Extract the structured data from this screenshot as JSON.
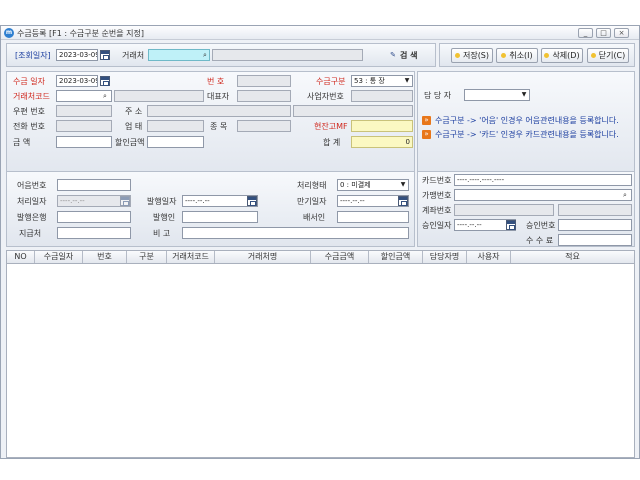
{
  "window": {
    "title": "수금등록 [F1 : 수금구분 순번을 지정]",
    "app_icon": "m",
    "controls": [
      "minimize-icon",
      "maximize-icon",
      "close-icon"
    ]
  },
  "search": {
    "date_label": "[조회일자]",
    "date_value": "2023-03-09",
    "client_label": "거래처",
    "client_value": "",
    "search_label": "검 색"
  },
  "toolbar": {
    "save": "저장(S)",
    "cancel": "취소(I)",
    "delete": "삭제(D)",
    "close": "닫기(C)"
  },
  "form": {
    "collect_date_label": "수금 일자",
    "collect_date_value": "2023-03-09",
    "number_label": "번 호",
    "collect_type_label": "수금구분",
    "collect_type_value": "53 : 통 장",
    "client_code_label": "거래처코드",
    "rep_label": "대표자",
    "bizno_label": "사업자번호",
    "manager_label": "담 당 자",
    "zip_label": "우편 번호",
    "address_label": "주 소",
    "phone_label": "전화 번호",
    "biztype_label": "업 태",
    "item_label": "종 목",
    "balance_label": "현잔고MF",
    "amount_label": "금 액",
    "discount_label": "할인금액",
    "total_label": "합 계",
    "total_value": "0",
    "note1": "수금구분 -> '어음' 인경우 어음관련내용을 등록합니다.",
    "note2": "수금구분 -> '카드' 인경우 카드관련내용을 등록합니다."
  },
  "bill": {
    "bill_no_label": "어음번호",
    "process_type_label": "처리형태",
    "process_type_value": "0 : 미결제",
    "process_date_label": "처리일자",
    "process_date_value": "----.--.--",
    "issue_date_label": "발행일자",
    "issue_date_value": "----.--.--",
    "due_date_label": "만기일자",
    "due_date_value": "----.--.--",
    "bank_label": "발행은행",
    "issuer_label": "발행인",
    "endorser_label": "배서인",
    "place_label": "지급처",
    "memo_label": "비 고"
  },
  "card": {
    "card_no_label": "카드번호",
    "card_no_value": "----.----.----.----",
    "merchant_label": "가맹번호",
    "account_label": "계좌번호",
    "approve_date_label": "승인일자",
    "approve_date_value": "----.--.--",
    "approve_no_label": "승인번호",
    "fee_label": "수 수 료"
  },
  "grid": {
    "columns": [
      "NO",
      "수금일자",
      "번호",
      "구분",
      "거래처코드",
      "거래처명",
      "수금금액",
      "할인금액",
      "담당자명",
      "사용자",
      "적요"
    ]
  }
}
